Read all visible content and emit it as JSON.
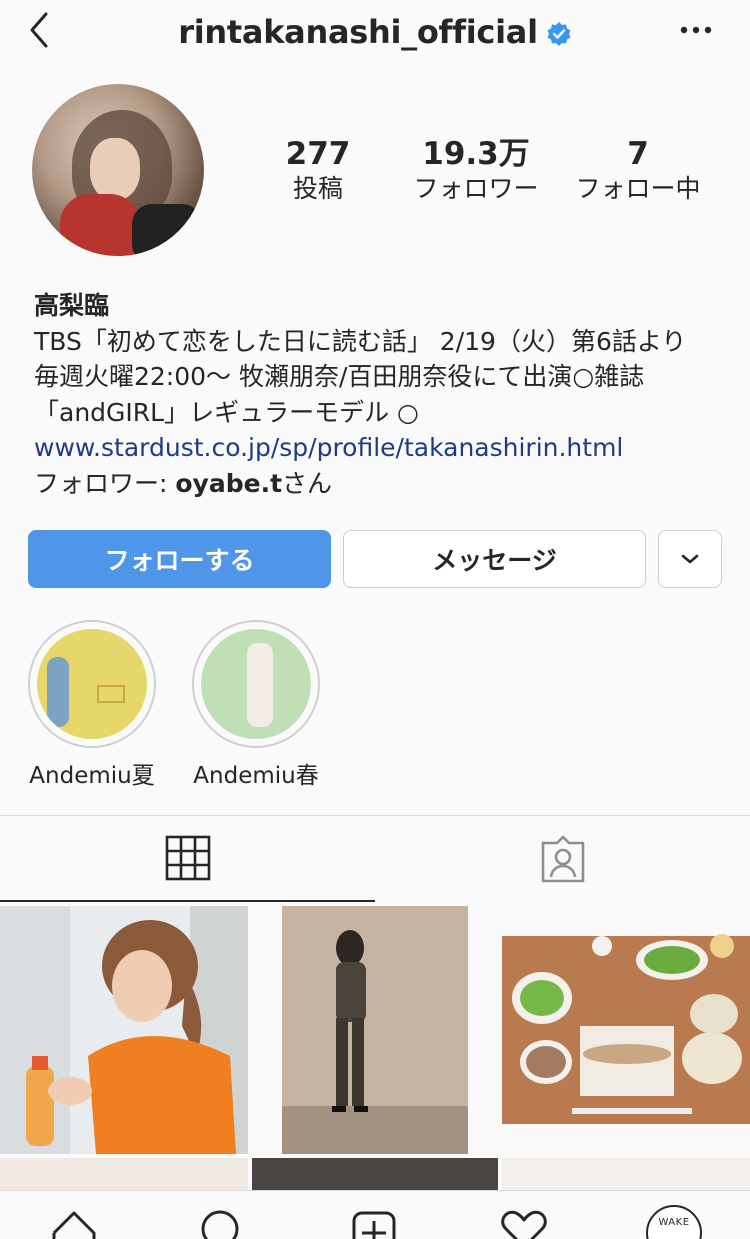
{
  "header": {
    "username": "rintakanashi_official",
    "verified": true
  },
  "stats": {
    "posts_value": "277",
    "posts_label": "投稿",
    "followers_value": "19.3万",
    "followers_label": "フォロワー",
    "following_value": "7",
    "following_label": "フォロー中"
  },
  "bio": {
    "name": "高梨臨",
    "line1": "TBS「初めて恋をした日に読む話」 2/19（火）第6話より",
    "line2": "毎週火曜22:00〜 牧瀬朋奈/百田朋奈役にて出演○雑誌",
    "line3": "「andGIRL」レギュラーモデル ○",
    "link": "www.stardust.co.jp/sp/profile/takanashirin.html",
    "followed_prefix": "フォロワー: ",
    "followed_user": "oyabe.t",
    "followed_suffix": "さん"
  },
  "actions": {
    "follow_label": "フォローする",
    "message_label": "メッセージ"
  },
  "highlights": [
    {
      "label": "Andemiu夏"
    },
    {
      "label": "Andemiu春"
    }
  ],
  "nav": {
    "profile_badge": "WAKE"
  },
  "colors": {
    "accent": "#4f95e8",
    "link": "#1e3a8a",
    "verified": "#3897f0"
  }
}
